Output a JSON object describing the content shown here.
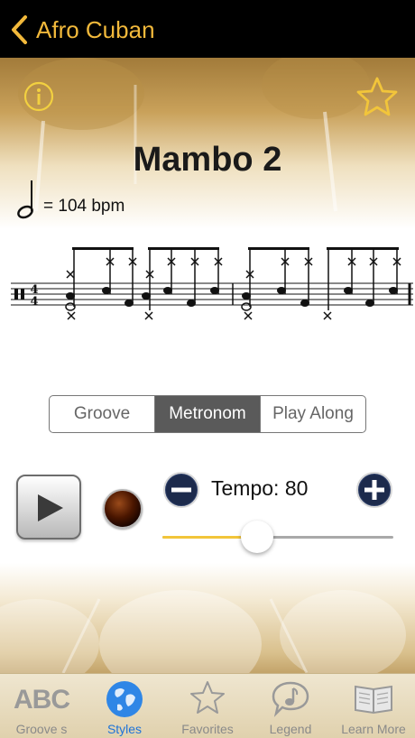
{
  "nav": {
    "title": "Afro Cuban"
  },
  "song": {
    "title": "Mambo 2",
    "tempo_marking": "= 104 bpm"
  },
  "modes": [
    {
      "label": "Groove",
      "active": false
    },
    {
      "label": "Metronom",
      "active": true
    },
    {
      "label": "Play Along",
      "active": false
    }
  ],
  "controls": {
    "tempo_label": "Tempo: 80",
    "tempo_slider_fraction": 0.41
  },
  "tabs": [
    {
      "label": "Groove s",
      "icon": "abc-icon",
      "active": false
    },
    {
      "label": "Styles",
      "icon": "globe-icon",
      "active": true
    },
    {
      "label": "Favorites",
      "icon": "star-icon",
      "active": false
    },
    {
      "label": "Legend",
      "icon": "music-note-bubble-icon",
      "active": false
    },
    {
      "label": "Learn More",
      "icon": "book-icon",
      "active": false
    }
  ],
  "tabbar_icons": {
    "abc_text": "ABC"
  },
  "colors": {
    "accent": "#f2b93b",
    "tab_active": "#1e73d8",
    "slider_fill": "#f2c53a"
  }
}
